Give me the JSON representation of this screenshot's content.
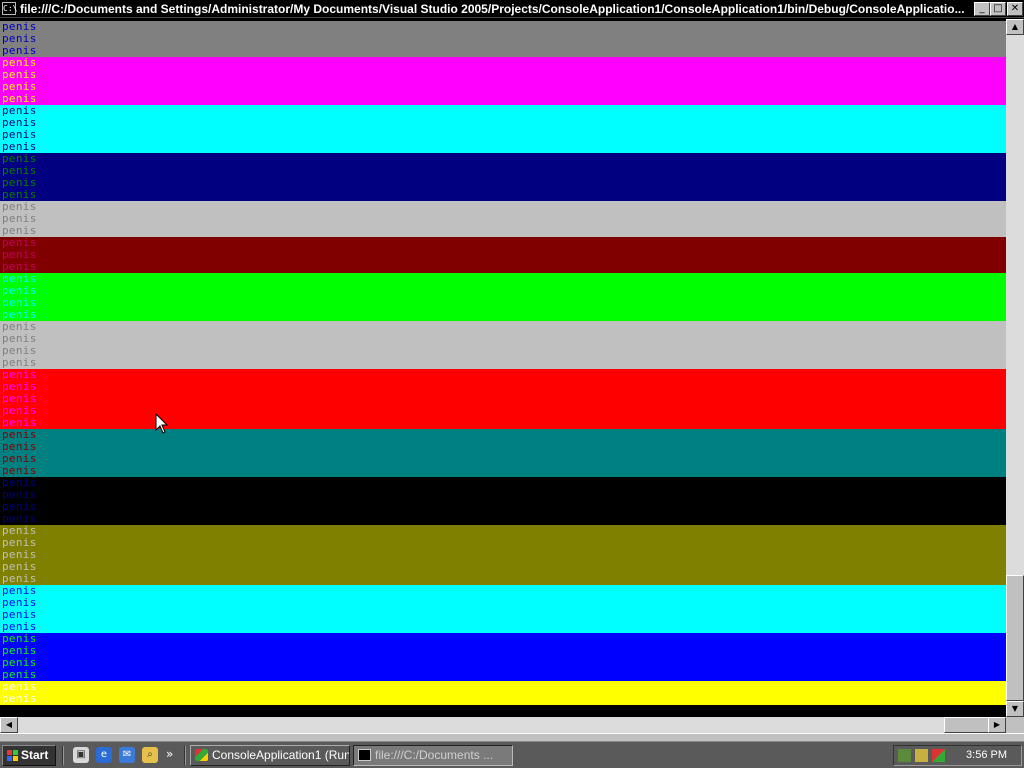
{
  "window": {
    "icon_label": "C:\\",
    "title": "file:///C:/Documents and Settings/Administrator/My Documents/Visual Studio 2005/Projects/ConsoleApplication1/ConsoleApplication1/bin/Debug/ConsoleApplicatio...",
    "controls": {
      "minimize": "_",
      "maximize": "□",
      "close": "✕"
    }
  },
  "console": {
    "text": "penis",
    "rows": [
      {
        "fg": "#0000c0",
        "bg": "#808080"
      },
      {
        "fg": "#0000c0",
        "bg": "#808080"
      },
      {
        "fg": "#0000c0",
        "bg": "#808080"
      },
      {
        "fg": "#ffff00",
        "bg": "#ff00ff"
      },
      {
        "fg": "#ffff00",
        "bg": "#ff00ff"
      },
      {
        "fg": "#ffff00",
        "bg": "#ff00ff"
      },
      {
        "fg": "#ffff00",
        "bg": "#ff00ff"
      },
      {
        "fg": "#000080",
        "bg": "#00ffff"
      },
      {
        "fg": "#000080",
        "bg": "#00ffff"
      },
      {
        "fg": "#000080",
        "bg": "#00ffff"
      },
      {
        "fg": "#000080",
        "bg": "#00ffff"
      },
      {
        "fg": "#008000",
        "bg": "#000080"
      },
      {
        "fg": "#008000",
        "bg": "#000080"
      },
      {
        "fg": "#008000",
        "bg": "#000080"
      },
      {
        "fg": "#008000",
        "bg": "#000080"
      },
      {
        "fg": "#808080",
        "bg": "#c0c0c0"
      },
      {
        "fg": "#808080",
        "bg": "#c0c0c0"
      },
      {
        "fg": "#808080",
        "bg": "#c0c0c0"
      },
      {
        "fg": "#c00060",
        "bg": "#800000"
      },
      {
        "fg": "#c00060",
        "bg": "#800000"
      },
      {
        "fg": "#c00060",
        "bg": "#800000"
      },
      {
        "fg": "#00ffff",
        "bg": "#00ff00"
      },
      {
        "fg": "#00ffff",
        "bg": "#00ff00"
      },
      {
        "fg": "#00ffff",
        "bg": "#00ff00"
      },
      {
        "fg": "#00ffff",
        "bg": "#00ff00"
      },
      {
        "fg": "#808080",
        "bg": "#c0c0c0"
      },
      {
        "fg": "#808080",
        "bg": "#c0c0c0"
      },
      {
        "fg": "#808080",
        "bg": "#c0c0c0"
      },
      {
        "fg": "#808080",
        "bg": "#c0c0c0"
      },
      {
        "fg": "#ff00ff",
        "bg": "#ff0000"
      },
      {
        "fg": "#ff00ff",
        "bg": "#ff0000"
      },
      {
        "fg": "#ff00ff",
        "bg": "#ff0000"
      },
      {
        "fg": "#ff00ff",
        "bg": "#ff0000"
      },
      {
        "fg": "#ff00ff",
        "bg": "#ff0000"
      },
      {
        "fg": "#800000",
        "bg": "#008080"
      },
      {
        "fg": "#800000",
        "bg": "#008080"
      },
      {
        "fg": "#800000",
        "bg": "#008080"
      },
      {
        "fg": "#800000",
        "bg": "#008080"
      },
      {
        "fg": "#000080",
        "bg": "#000000"
      },
      {
        "fg": "#000080",
        "bg": "#000000"
      },
      {
        "fg": "#000080",
        "bg": "#000000"
      },
      {
        "fg": "#000080",
        "bg": "#000000"
      },
      {
        "fg": "#c0c0c0",
        "bg": "#808000"
      },
      {
        "fg": "#c0c0c0",
        "bg": "#808000"
      },
      {
        "fg": "#c0c0c0",
        "bg": "#808000"
      },
      {
        "fg": "#c0c0c0",
        "bg": "#808000"
      },
      {
        "fg": "#c0c0c0",
        "bg": "#808000"
      },
      {
        "fg": "#0000ff",
        "bg": "#00ffff"
      },
      {
        "fg": "#0000ff",
        "bg": "#00ffff"
      },
      {
        "fg": "#0000ff",
        "bg": "#00ffff"
      },
      {
        "fg": "#0000ff",
        "bg": "#00ffff"
      },
      {
        "fg": "#00ff00",
        "bg": "#0000ff"
      },
      {
        "fg": "#00ff00",
        "bg": "#0000ff"
      },
      {
        "fg": "#00ff00",
        "bg": "#0000ff"
      },
      {
        "fg": "#00ff00",
        "bg": "#0000ff"
      },
      {
        "fg": "#ffffff",
        "bg": "#ffff00"
      },
      {
        "fg": "#ffffff",
        "bg": "#ffff00"
      }
    ]
  },
  "taskbar": {
    "start_label": "Start",
    "quicklaunch": [
      "show-desktop-icon",
      "ie-icon",
      "outlook-icon",
      "explorer-icon"
    ],
    "more_chevron": "»",
    "tasks": [
      {
        "label": "ConsoleApplication1 (Run...",
        "active": false
      },
      {
        "label": "file:///C:/Documents ...",
        "active": true
      }
    ],
    "clock": "3:56 PM"
  }
}
